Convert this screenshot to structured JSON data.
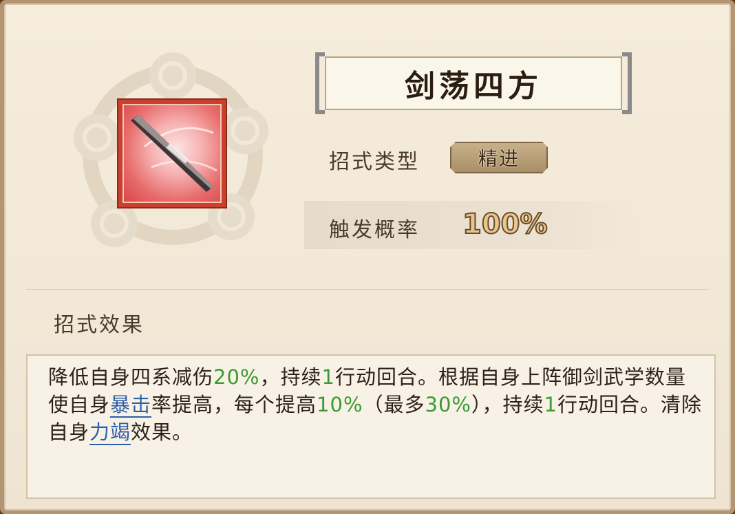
{
  "skill": {
    "name": "剑荡四方",
    "icon": "sword-icon"
  },
  "info": {
    "type_label": "招式类型",
    "type_value": "精进",
    "prob_label": "触发概率",
    "prob_value": "100%"
  },
  "effect": {
    "heading": "招式效果",
    "segments": [
      {
        "t": "降低自身四系减伤",
        "c": "text"
      },
      {
        "t": "20%",
        "c": "num"
      },
      {
        "t": "，持续",
        "c": "text"
      },
      {
        "t": "1",
        "c": "num"
      },
      {
        "t": "行动回合。根据自身上阵御剑武学数量使自身",
        "c": "text"
      },
      {
        "t": "暴击",
        "c": "kw"
      },
      {
        "t": "率提高，每个提高",
        "c": "text"
      },
      {
        "t": "10%",
        "c": "num"
      },
      {
        "t": "（最多",
        "c": "text"
      },
      {
        "t": "30%",
        "c": "num"
      },
      {
        "t": "），持续",
        "c": "text"
      },
      {
        "t": "1",
        "c": "num"
      },
      {
        "t": "行动回合。清除自身",
        "c": "text"
      },
      {
        "t": "力竭",
        "c": "kw"
      },
      {
        "t": "效果。",
        "c": "text"
      }
    ]
  },
  "colors": {
    "number": "#3c9a34",
    "keyword": "#2b5fa8"
  }
}
